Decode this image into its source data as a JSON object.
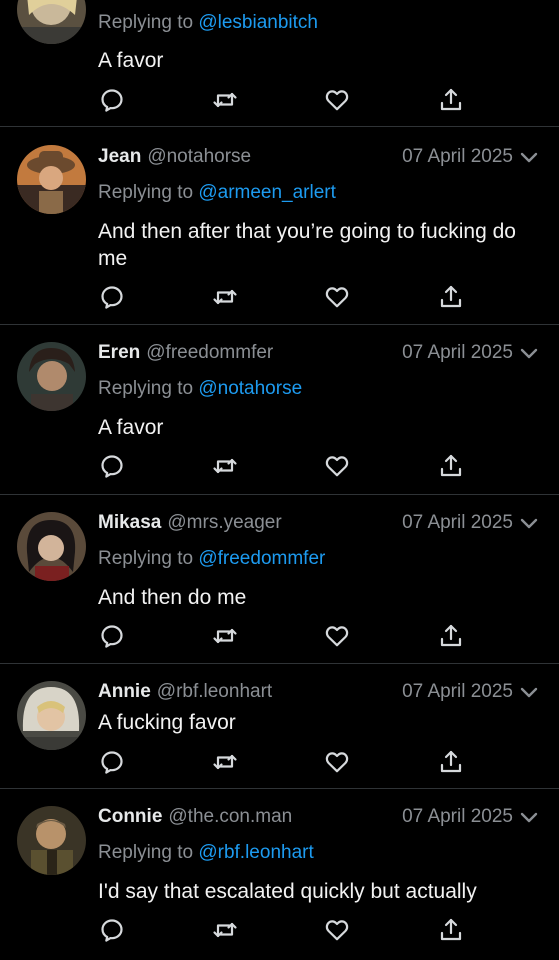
{
  "labels": {
    "replying_to": "Replying to "
  },
  "tweets": [
    {
      "name": "",
      "handle": "",
      "date": "",
      "replying_to": "@lesbianbitch",
      "text": "A favor"
    },
    {
      "name": "Jean",
      "handle": "@notahorse",
      "date": "07 April 2025",
      "replying_to": "@armeen_arlert",
      "text": "And then after that you’re going to fucking do me"
    },
    {
      "name": "Eren",
      "handle": "@freedommfer",
      "date": "07 April 2025",
      "replying_to": "@notahorse",
      "text": "A favor"
    },
    {
      "name": "Mikasa",
      "handle": "@mrs.yeager",
      "date": "07 April 2025",
      "replying_to": "@freedommfer",
      "text": "And then do me"
    },
    {
      "name": "Annie",
      "handle": "@rbf.leonhart",
      "date": "07 April 2025",
      "replying_to": "",
      "text": "A fucking favor"
    },
    {
      "name": "Connie",
      "handle": "@the.con.man",
      "date": "07 April 2025",
      "replying_to": "@rbf.leonhart",
      "text": "I'd say that escalated quickly but actually"
    }
  ],
  "icons": {
    "reply": "reply-icon",
    "retweet": "retweet-icon",
    "like": "like-icon",
    "share": "share-icon",
    "menu": "chevron-down-icon"
  },
  "colors": {
    "background": "#000000",
    "link": "#1d9bf0",
    "muted": "#8b8f94",
    "divider": "#2f3336"
  }
}
